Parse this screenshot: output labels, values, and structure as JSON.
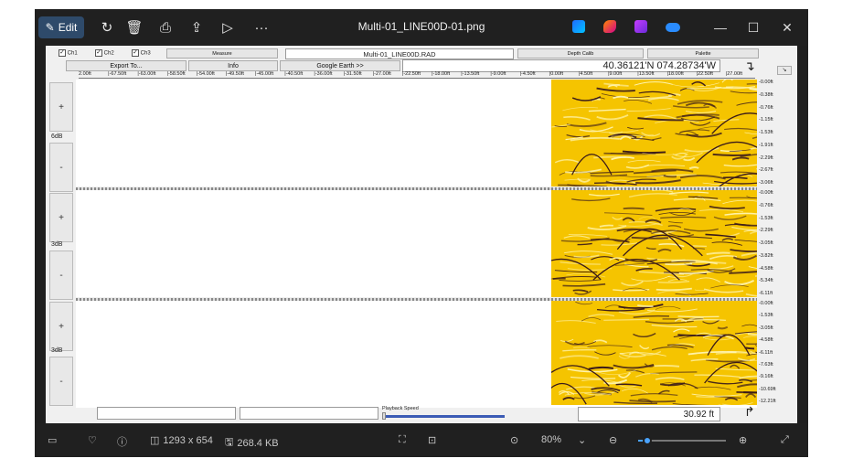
{
  "titlebar": {
    "edit_label": "Edit",
    "file_title": "Multi-01_LINE00D-01.png",
    "icons": [
      "rotate-icon",
      "delete-icon",
      "print-icon",
      "share-icon",
      "slideshow-icon",
      "more-icon"
    ],
    "app_icons": [
      "designer-icon",
      "copilot-icon",
      "clipchamp-icon",
      "onedrive-icon"
    ],
    "controls": {
      "minimize": "—",
      "maximize": "☐",
      "close": "✕"
    }
  },
  "toolbar": {
    "channels": [
      {
        "label": "Ch1",
        "checked": true
      },
      {
        "label": "Ch2",
        "checked": true
      },
      {
        "label": "Ch3",
        "checked": true
      }
    ],
    "measure_label": "Measure",
    "filename": "Multi-01_LINE00D.RAD",
    "depth_calib_label": "Depth Calib",
    "palette_label": "Palette",
    "export_label": "Export To...",
    "info_label": "Info",
    "google_earth_label": "Google Earth >>",
    "coordinates": "40.36121'N 074.28734'W"
  },
  "ruler": {
    "ticks": [
      "2.00ft",
      "|-67.50ft",
      "|-63.00ft",
      "|-58.50ft",
      "|-54.00ft",
      "|-49.50ft",
      "|-45.00ft",
      "|-40.50ft",
      "|-36.00ft",
      "|-31.50ft",
      "|-27.00ft",
      "|-22.50ft",
      "|-18.00ft",
      "|-13.50ft",
      "|-9.00ft",
      "|-4.50ft",
      "|0.00ft",
      "|4.50ft",
      "|9.00ft",
      "|13.50ft",
      "|18.00ft",
      "|22.50ft",
      "|27.00ft"
    ]
  },
  "channels": [
    {
      "gain": "6dB",
      "plus": "+",
      "minus": "-",
      "depths": [
        "0.00ft",
        "0.38ft",
        "0.76ft",
        "1.15ft",
        "1.53ft",
        "1.91ft",
        "2.29ft",
        "2.67ft",
        "3.06ft"
      ]
    },
    {
      "gain": "3dB",
      "plus": "+",
      "minus": "-",
      "depths": [
        "0.00ft",
        "0.76ft",
        "1.53ft",
        "2.29ft",
        "3.05ft",
        "3.82ft",
        "4.58ft",
        "5.34ft",
        "6.11ft"
      ]
    },
    {
      "gain": "3dB",
      "plus": "+",
      "minus": "-",
      "depths": [
        "0.00ft",
        "1.53ft",
        "3.05ft",
        "4.58ft",
        "6.11ft",
        "7.63ft",
        "9.16ft",
        "10.69ft",
        "12.21ft"
      ]
    }
  ],
  "bottom": {
    "playback_label": "Playback Speed",
    "playback_value": 0.0,
    "distance": "30.92 ft"
  },
  "statusbar": {
    "dimensions": "1293 x 654",
    "file_size": "268.4 KB",
    "zoom": "80%",
    "zoom_level": 0.1
  },
  "colors": {
    "radar_background": "#f5c400",
    "radar_dark": "#3a1a1a",
    "radar_light": "#fff4b0",
    "accent": "#4aa3ff"
  }
}
